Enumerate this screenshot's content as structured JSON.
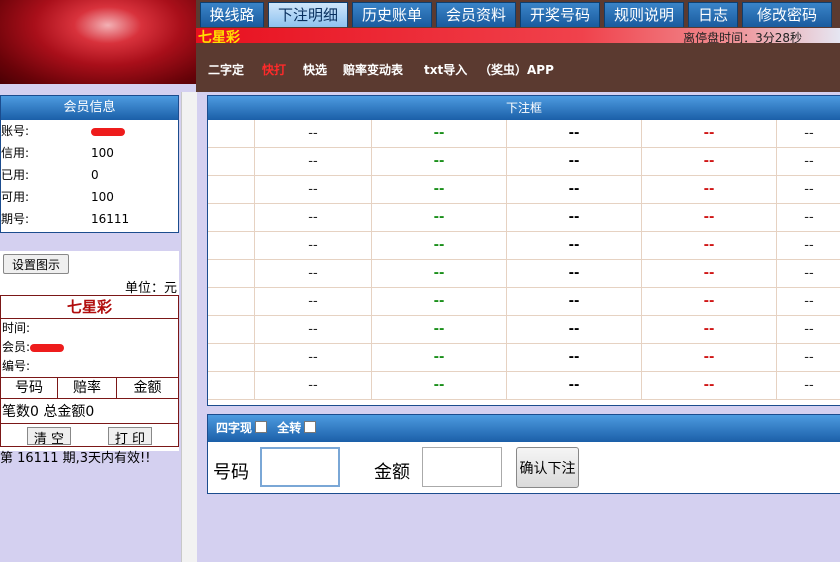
{
  "nav": {
    "tabs": [
      {
        "label": "换线路"
      },
      {
        "label": "下注明细"
      },
      {
        "label": "历史账单"
      },
      {
        "label": "会员资料"
      },
      {
        "label": "开奖号码"
      },
      {
        "label": "规则说明"
      },
      {
        "label": "日志"
      },
      {
        "label": "修改密码"
      }
    ],
    "active_index": 1
  },
  "titlebar": {
    "lottery_name": "七星彩",
    "countdown": "离停盘时间：3分28秒"
  },
  "submenu": [
    {
      "label": "二字定"
    },
    {
      "label": "快打"
    },
    {
      "label": "快选"
    },
    {
      "label": "赔率变动表"
    },
    {
      "label": "txt导入"
    },
    {
      "label": "（奖虫）APP"
    }
  ],
  "member_info": {
    "title": "会员信息",
    "rows": [
      {
        "label": "账号:",
        "value": ""
      },
      {
        "label": "信用:",
        "value": "100"
      },
      {
        "label": "已用:",
        "value": "0"
      },
      {
        "label": "可用:",
        "value": "100"
      },
      {
        "label": "期号:",
        "value": "16111"
      }
    ]
  },
  "settings_button": "设置图示",
  "unit_label": "单位：元",
  "slip": {
    "title": "七星彩",
    "time_label": "时间:",
    "member_label": "会员:",
    "serial_label": "编号:",
    "columns": [
      "号码",
      "赔率",
      "金额"
    ],
    "totals": "笔数0 总金额0",
    "clear_button": "清 空",
    "print_button": "打 印"
  },
  "valid_note": "第 16111 期,3天内有效!!",
  "bet_table": {
    "title": "下注框",
    "rows": [
      [
        "",
        "--",
        "--",
        "--",
        "--",
        "--"
      ],
      [
        "",
        "--",
        "--",
        "--",
        "--",
        "--"
      ],
      [
        "",
        "--",
        "--",
        "--",
        "--",
        "--"
      ],
      [
        "",
        "--",
        "--",
        "--",
        "--",
        "--"
      ],
      [
        "",
        "--",
        "--",
        "--",
        "--",
        "--"
      ],
      [
        "",
        "--",
        "--",
        "--",
        "--",
        "--"
      ],
      [
        "",
        "--",
        "--",
        "--",
        "--",
        "--"
      ],
      [
        "",
        "--",
        "--",
        "--",
        "--",
        "--"
      ],
      [
        "",
        "--",
        "--",
        "--",
        "--",
        "--"
      ],
      [
        "",
        "--",
        "--",
        "--",
        "--",
        "--"
      ]
    ]
  },
  "input_panel": {
    "four_digit_label": "四字现",
    "all_rotate_label": "全转",
    "code_label": "号码",
    "amount_label": "金额",
    "confirm_button": "确认下注",
    "code_value": "",
    "amount_value": ""
  },
  "colors": {
    "nav_background": "#5b3a30",
    "tab_blue": "#1a5b9e",
    "active_tab": "#8ec2ef",
    "title_red": "#e8101f",
    "lottery_name_yellow": "#ffe000",
    "page_background": "#d4d0f0"
  }
}
